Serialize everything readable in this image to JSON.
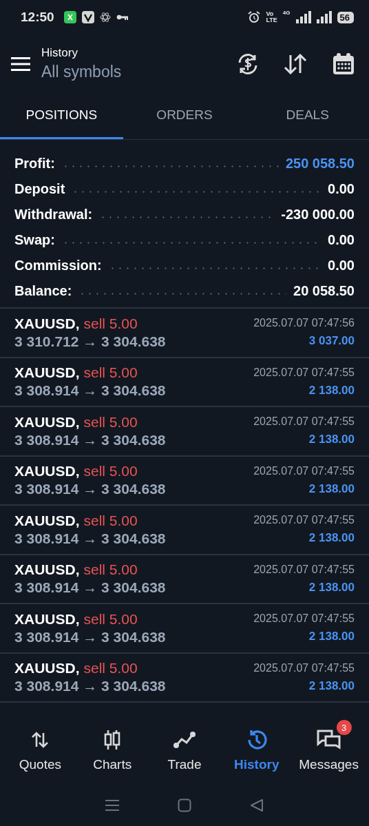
{
  "status_bar": {
    "time": "12:50",
    "volte": [
      "Vo",
      "LTE"
    ],
    "network": "4G",
    "battery": "56"
  },
  "header": {
    "title": "History",
    "subtitle": "All symbols"
  },
  "tabs": [
    {
      "label": "POSITIONS",
      "selected": true
    },
    {
      "label": "ORDERS",
      "selected": false
    },
    {
      "label": "DEALS",
      "selected": false
    }
  ],
  "summary": [
    {
      "label": "Profit:",
      "value": "250 058.50",
      "highlight": true
    },
    {
      "label": "Deposit",
      "value": "0.00",
      "highlight": false
    },
    {
      "label": "Withdrawal:",
      "value": "-230 000.00",
      "highlight": false
    },
    {
      "label": "Swap:",
      "value": "0.00",
      "highlight": false
    },
    {
      "label": "Commission:",
      "value": "0.00",
      "highlight": false
    },
    {
      "label": "Balance:",
      "value": "20 058.50",
      "highlight": false
    }
  ],
  "deals": [
    {
      "symbol": "XAUUSD,",
      "side": "sell",
      "volume": "5.00",
      "prices": "3 310.712 → 3 304.638",
      "time": "2025.07.07 07:47:56",
      "profit": "3 037.00"
    },
    {
      "symbol": "XAUUSD,",
      "side": "sell",
      "volume": "5.00",
      "prices": "3 308.914 → 3 304.638",
      "time": "2025.07.07 07:47:55",
      "profit": "2 138.00"
    },
    {
      "symbol": "XAUUSD,",
      "side": "sell",
      "volume": "5.00",
      "prices": "3 308.914 → 3 304.638",
      "time": "2025.07.07 07:47:55",
      "profit": "2 138.00"
    },
    {
      "symbol": "XAUUSD,",
      "side": "sell",
      "volume": "5.00",
      "prices": "3 308.914 → 3 304.638",
      "time": "2025.07.07 07:47:55",
      "profit": "2 138.00"
    },
    {
      "symbol": "XAUUSD,",
      "side": "sell",
      "volume": "5.00",
      "prices": "3 308.914 → 3 304.638",
      "time": "2025.07.07 07:47:55",
      "profit": "2 138.00"
    },
    {
      "symbol": "XAUUSD,",
      "side": "sell",
      "volume": "5.00",
      "prices": "3 308.914 → 3 304.638",
      "time": "2025.07.07 07:47:55",
      "profit": "2 138.00"
    },
    {
      "symbol": "XAUUSD,",
      "side": "sell",
      "volume": "5.00",
      "prices": "3 308.914 → 3 304.638",
      "time": "2025.07.07 07:47:55",
      "profit": "2 138.00"
    },
    {
      "symbol": "XAUUSD,",
      "side": "sell",
      "volume": "5.00",
      "prices": "3 308.914 → 3 304.638",
      "time": "2025.07.07 07:47:55",
      "profit": "2 138.00"
    }
  ],
  "bottom_nav": [
    {
      "kind": "quotes",
      "label": "Quotes",
      "selected": false
    },
    {
      "kind": "charts",
      "label": "Charts",
      "selected": false
    },
    {
      "kind": "trade",
      "label": "Trade",
      "selected": false
    },
    {
      "kind": "history",
      "label": "History",
      "selected": true
    },
    {
      "kind": "messages",
      "label": "Messages",
      "selected": false,
      "badge": "3"
    }
  ]
}
